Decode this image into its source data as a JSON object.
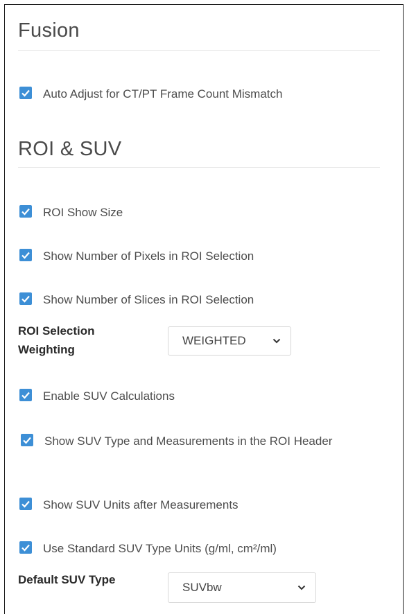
{
  "fusion": {
    "title": "Fusion",
    "items": [
      {
        "label": "Auto Adjust for CT/PT Frame Count Mismatch",
        "checked": true
      }
    ]
  },
  "roi_suv": {
    "title": "ROI & SUV",
    "items": [
      {
        "label": "ROI Show Size",
        "checked": true
      },
      {
        "label": "Show Number of Pixels in ROI Selection",
        "checked": true
      },
      {
        "label": "Show Number of Slices in ROI Selection",
        "checked": true
      }
    ],
    "weighting": {
      "label": "ROI Selection Weighting",
      "value": "WEIGHTED"
    },
    "suv_items": [
      {
        "label": "Enable SUV Calculations",
        "checked": true
      },
      {
        "label": "Show SUV Type and Measurements in the ROI Header",
        "checked": true
      },
      {
        "label": "Show SUV Units after Measurements",
        "checked": true
      },
      {
        "label": "Use Standard SUV Type Units (g/ml, cm²/ml)",
        "checked": true
      }
    ],
    "default_type": {
      "label": "Default SUV Type",
      "value": "SUVbw"
    }
  },
  "colors": {
    "checkbox": "#3d8fd6",
    "border": "#1f1f1f"
  }
}
